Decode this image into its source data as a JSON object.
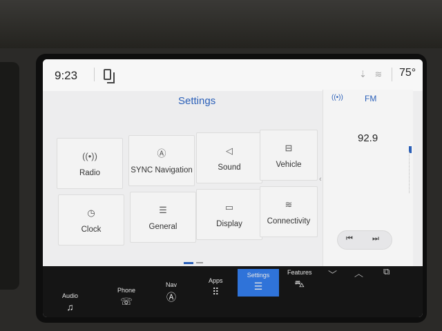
{
  "status": {
    "time": "9:23",
    "temperature": "75°",
    "icons": [
      "phone-mirror-icon",
      "download-icon",
      "wifi-icon"
    ]
  },
  "settings": {
    "title": "Settings",
    "tiles": [
      {
        "label": "Radio",
        "icon": "radio-icon"
      },
      {
        "label": "SYNC Navigation",
        "icon": "navigation-icon"
      },
      {
        "label": "Sound",
        "icon": "sound-icon"
      },
      {
        "label": "Vehicle",
        "icon": "vehicle-icon"
      },
      {
        "label": "Clock",
        "icon": "clock-icon"
      },
      {
        "label": "General",
        "icon": "sliders-icon"
      },
      {
        "label": "Display",
        "icon": "display-icon"
      },
      {
        "label": "Connectivity",
        "icon": "wifi-icon"
      }
    ]
  },
  "side_panel": {
    "band": "FM",
    "frequency": "92.9"
  },
  "nav": [
    {
      "label": "Audio",
      "icon": "music-note-icon"
    },
    {
      "label": "Phone",
      "icon": "phone-icon"
    },
    {
      "label": "Nav",
      "icon": "navigation-icon"
    },
    {
      "label": "Apps",
      "icon": "apps-grid-icon"
    },
    {
      "label": "Settings",
      "icon": "sliders-icon",
      "active": true
    },
    {
      "label": "Features",
      "icon": "car-icon"
    }
  ],
  "colors": {
    "accent": "#2a5fb8",
    "active_tab": "#2f73d9",
    "nav_bg": "#151515",
    "screen_bg": "#ededee"
  }
}
